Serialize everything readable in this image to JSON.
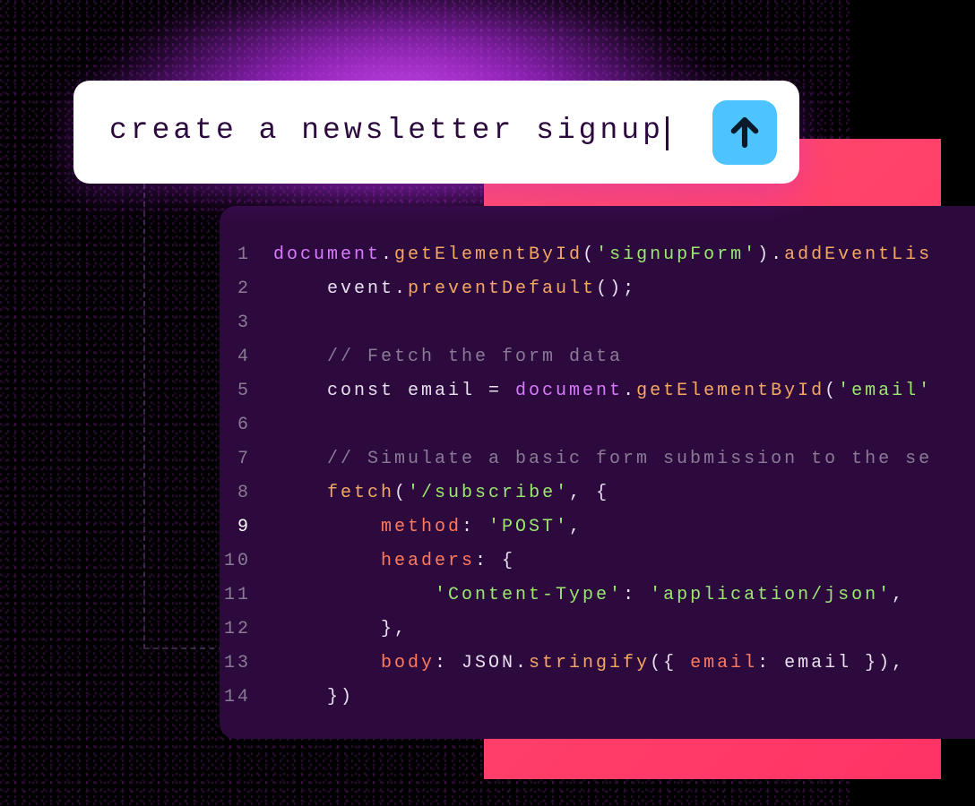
{
  "prompt": {
    "text": "create a newsletter signup",
    "send_icon": "arrow-up"
  },
  "code": {
    "active_line": 9,
    "lines": [
      {
        "n": 1,
        "tokens": [
          {
            "t": "document",
            "c": "obj"
          },
          {
            "t": ".",
            "c": ""
          },
          {
            "t": "getElementById",
            "c": "method"
          },
          {
            "t": "(",
            "c": ""
          },
          {
            "t": "'signupForm'",
            "c": "str"
          },
          {
            "t": ").",
            "c": ""
          },
          {
            "t": "addEventLis",
            "c": "method"
          }
        ]
      },
      {
        "n": 2,
        "tokens": [
          {
            "t": "    event.",
            "c": ""
          },
          {
            "t": "preventDefault",
            "c": "method"
          },
          {
            "t": "();",
            "c": ""
          }
        ]
      },
      {
        "n": 3,
        "tokens": []
      },
      {
        "n": 4,
        "tokens": [
          {
            "t": "    // Fetch the form data",
            "c": "comment"
          }
        ]
      },
      {
        "n": 5,
        "tokens": [
          {
            "t": "    const email = ",
            "c": ""
          },
          {
            "t": "document",
            "c": "obj"
          },
          {
            "t": ".",
            "c": ""
          },
          {
            "t": "getElementById",
            "c": "method"
          },
          {
            "t": "(",
            "c": ""
          },
          {
            "t": "'email'",
            "c": "str"
          }
        ]
      },
      {
        "n": 6,
        "tokens": []
      },
      {
        "n": 7,
        "tokens": [
          {
            "t": "    // Simulate a basic form submission to the se",
            "c": "comment"
          }
        ]
      },
      {
        "n": 8,
        "tokens": [
          {
            "t": "    ",
            "c": ""
          },
          {
            "t": "fetch",
            "c": "method"
          },
          {
            "t": "(",
            "c": ""
          },
          {
            "t": "'/subscribe'",
            "c": "str"
          },
          {
            "t": ", {",
            "c": ""
          }
        ]
      },
      {
        "n": 9,
        "tokens": [
          {
            "t": "        ",
            "c": ""
          },
          {
            "t": "method",
            "c": "prop"
          },
          {
            "t": ": ",
            "c": ""
          },
          {
            "t": "'POST'",
            "c": "str"
          },
          {
            "t": ",",
            "c": ""
          }
        ]
      },
      {
        "n": 10,
        "tokens": [
          {
            "t": "        ",
            "c": ""
          },
          {
            "t": "headers",
            "c": "prop"
          },
          {
            "t": ": {",
            "c": ""
          }
        ]
      },
      {
        "n": 11,
        "tokens": [
          {
            "t": "            ",
            "c": ""
          },
          {
            "t": "'Content-Type'",
            "c": "str"
          },
          {
            "t": ": ",
            "c": ""
          },
          {
            "t": "'application/json'",
            "c": "str"
          },
          {
            "t": ",",
            "c": ""
          }
        ]
      },
      {
        "n": 12,
        "tokens": [
          {
            "t": "        },",
            "c": ""
          }
        ]
      },
      {
        "n": 13,
        "tokens": [
          {
            "t": "        ",
            "c": ""
          },
          {
            "t": "body",
            "c": "prop"
          },
          {
            "t": ": JSON.",
            "c": ""
          },
          {
            "t": "stringify",
            "c": "method"
          },
          {
            "t": "({ ",
            "c": ""
          },
          {
            "t": "email",
            "c": "prop"
          },
          {
            "t": ": email }),",
            "c": ""
          }
        ]
      },
      {
        "n": 14,
        "tokens": [
          {
            "t": "    })",
            "c": ""
          }
        ]
      }
    ]
  }
}
